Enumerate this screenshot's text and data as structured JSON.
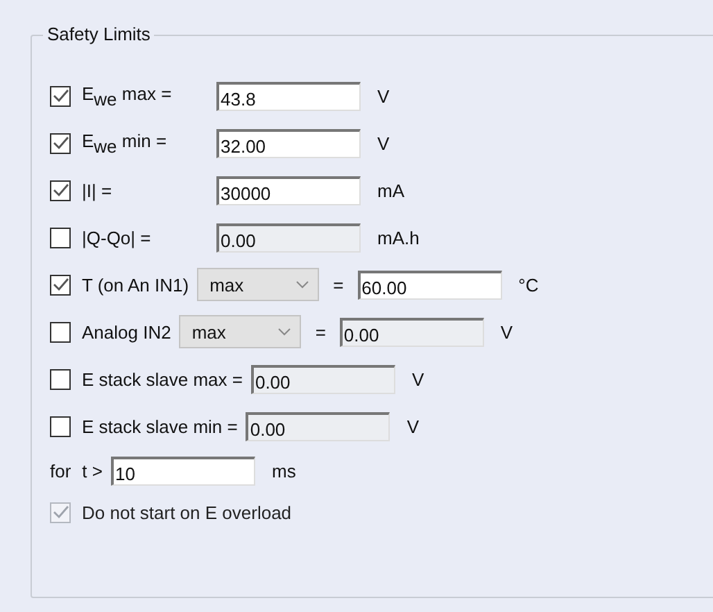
{
  "group": {
    "title": "Safety Limits"
  },
  "rows": [
    {
      "kind": "limit",
      "checked": true,
      "label": "E$_{we}$  max =",
      "value": "43.8",
      "disabled": false,
      "unit": "V"
    },
    {
      "kind": "limit",
      "checked": true,
      "label": "E$_{we}$  min =",
      "value": "32.00",
      "disabled": false,
      "unit": "V"
    },
    {
      "kind": "limit",
      "checked": true,
      "label": "|I| =",
      "value": "30000",
      "disabled": false,
      "unit": "mA"
    },
    {
      "kind": "limit",
      "checked": false,
      "label": "|Q-Qo| =",
      "value": "0.00",
      "disabled": true,
      "unit": "mA.h"
    },
    {
      "kind": "select",
      "checked": true,
      "label": "T (on An IN1)",
      "select": "max",
      "equals": "=",
      "value": "60.00",
      "disabled": false,
      "unit": "°C"
    },
    {
      "kind": "select",
      "checked": false,
      "label": "Analog IN2",
      "select": "max",
      "equals": "=",
      "value": "0.00",
      "disabled": true,
      "unit": "V"
    },
    {
      "kind": "free",
      "checked": false,
      "label": "E stack slave max =",
      "value": "0.00",
      "disabled": true,
      "unit": "V"
    },
    {
      "kind": "free",
      "checked": false,
      "label": " E stack slave min =",
      "value": "0.00",
      "disabled": true,
      "unit": "V"
    }
  ],
  "duration": {
    "label": "for",
    "prefix": "t >",
    "value": "10",
    "unit": "ms"
  },
  "overload": {
    "label": "Do not start on E overload",
    "checked": true,
    "disabled": true
  }
}
